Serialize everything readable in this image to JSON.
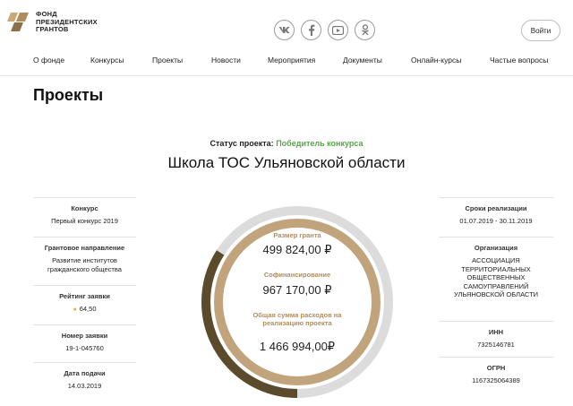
{
  "header": {
    "logo_lines": [
      "ФОНД",
      "ПРЕЗИДЕНТСКИХ",
      "ГРАНТОВ"
    ],
    "socials": [
      "vk-icon",
      "facebook-icon",
      "youtube-icon",
      "odnoklassniki-icon"
    ],
    "login_label": "Войти"
  },
  "nav": {
    "items": [
      "О фонде",
      "Конкурсы",
      "Проекты",
      "Новости",
      "Мероприятия",
      "Документы",
      "Онлайн-курсы",
      "Частые вопросы"
    ]
  },
  "page": {
    "title": "Проекты"
  },
  "project": {
    "status_label": "Статус проекта:",
    "status_value": "Победитель конкурса",
    "status_color": "#5aa34a",
    "title": "Школа ТОС Ульяновской области"
  },
  "left": {
    "contest_label": "Конкурс",
    "contest_value": "Первый конкурс 2019",
    "direction_label": "Грантовое направление",
    "direction_value_1": "Развитие институтов",
    "direction_value_2": "гражданского общества",
    "rating_label": "Рейтинг заявки",
    "rating_value": "64,50",
    "number_label": "Номер заявки",
    "number_value": "19-1-045760",
    "date_label": "Дата подачи",
    "date_value": "14.03.2019"
  },
  "right": {
    "period_label": "Сроки реализации",
    "period_value": "01.07.2019 - 30.11.2019",
    "org_label": "Организация",
    "org_lines": [
      "АССОЦИАЦИЯ",
      "ТЕРРИТОРИАЛЬНЫХ",
      "ОБЩЕСТВЕННЫХ",
      "САМОУПРАВЛЕНИЙ",
      "УЛЬЯНОВСКОЙ ОБЛАСТИ"
    ],
    "inn_label": "ИНН",
    "inn_value": "7325146781",
    "ogrn_label": "ОГРН",
    "ogrn_value": "1167325064389"
  },
  "finance": {
    "grant_label": "Размер гранта",
    "grant_value": "499 824,00 ₽",
    "cofin_label": "Софинансирование",
    "cofin_value": "967 170,00 ₽",
    "total_label_1": "Общая сумма расходов на",
    "total_label_2": "реализацию проекта",
    "total_value": "1 466 994,00₽",
    "colors": {
      "grant": "#5c4a2c",
      "cofin": "#c2a47c",
      "remainder": "#dcdcdc"
    }
  }
}
